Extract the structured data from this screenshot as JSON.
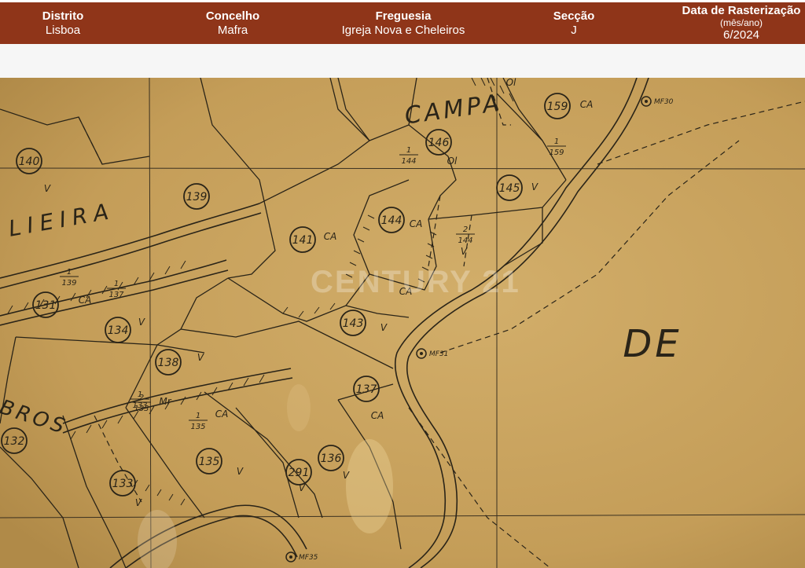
{
  "header": {
    "distrito": {
      "label": "Distrito",
      "value": "Lisboa"
    },
    "concelho": {
      "label": "Concelho",
      "value": "Mafra"
    },
    "freguesia": {
      "label": "Freguesia",
      "value": "Igreja Nova e Cheleiros"
    },
    "seccao": {
      "label": "Secção",
      "value": "J"
    },
    "data": {
      "label": "Data de Rasterização",
      "sublabel": "(mês/ano)",
      "value": "6/2024"
    }
  },
  "map": {
    "watermark": "CENTURY 21",
    "place_names": [
      "CAMPA",
      "LIEIRA",
      "BROS",
      "DE"
    ],
    "parcels": [
      "140",
      "139",
      "141",
      "144",
      "146",
      "145",
      "159",
      "131",
      "134",
      "138",
      "143",
      "137",
      "136",
      "291",
      "135",
      "133",
      "132"
    ],
    "fractions": [
      {
        "num": "1",
        "den": "144"
      },
      {
        "num": "2",
        "den": "144"
      },
      {
        "num": "1",
        "den": "159"
      },
      {
        "num": "1",
        "den": "139"
      },
      {
        "num": "1",
        "den": "137"
      },
      {
        "num": "1",
        "den": "135"
      },
      {
        "num": "1",
        "den": "133"
      },
      {
        "num": "2",
        "den": "133"
      }
    ],
    "land_use_codes": [
      "V",
      "CA",
      "Ol",
      "Mr"
    ],
    "markers": [
      "MF30",
      "MF31",
      "MF35"
    ],
    "colors": {
      "paper": "#c9a561",
      "ink": "#2a2418"
    }
  }
}
